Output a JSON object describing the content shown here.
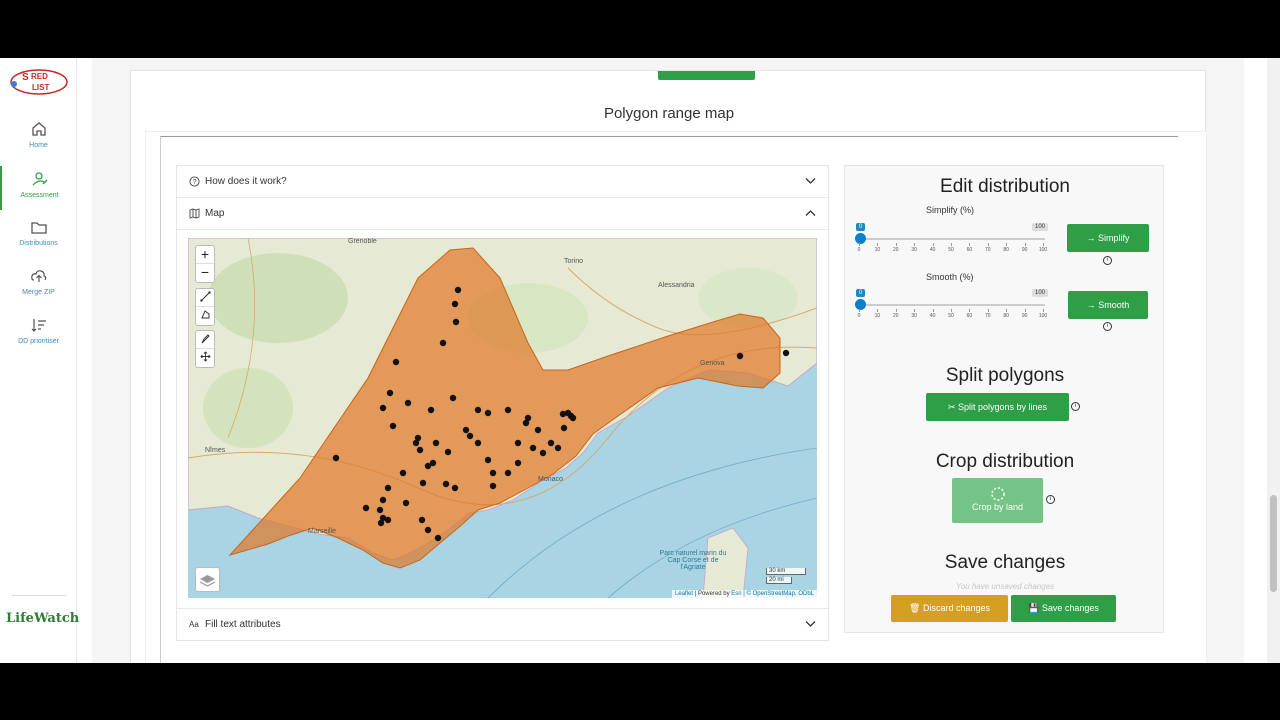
{
  "sidebar": {
    "logo_text": "RED LIST",
    "items": [
      {
        "label": "Home",
        "icon": "home-icon"
      },
      {
        "label": "Assessment",
        "icon": "user-edit-icon"
      },
      {
        "label": "Distributions",
        "icon": "folder-icon"
      },
      {
        "label": "Merge ZIP",
        "icon": "cloud-upload-icon"
      },
      {
        "label": "DD prioritiser",
        "icon": "sort-icon"
      }
    ],
    "partner_logo": "LifeWatch"
  },
  "section_title": "Polygon range map",
  "accordion": {
    "how_label": "How does it work?",
    "map_label": "Map",
    "fill_label": "Fill text attributes"
  },
  "map": {
    "zoom_in": "+",
    "zoom_out": "−",
    "scale_km": "30 km",
    "scale_mi": "20 mi",
    "attribution_leaflet": "Leaflet",
    "attribution_powered": " | Powered by ",
    "attribution_esri": "Esri",
    "attribution_osm": " | © OpenStreetMap, ODbL",
    "labels": {
      "torino": "Torino",
      "genova": "Genova",
      "monaco": "Monaco",
      "marseille": "Marseille",
      "nimes": "Nîmes",
      "grenoble": "Grenoble",
      "alessandria": "Alessandria",
      "corse": "Parc naturel marin du Cap Corse et de l'Agriate"
    }
  },
  "edit": {
    "title": "Edit distribution",
    "simplify_label": "Simplify (%)",
    "smooth_label": "Smooth (%)",
    "slider_min": "0",
    "slider_max": "100",
    "slider_value": 0,
    "ticks": [
      "0",
      "10",
      "20",
      "30",
      "40",
      "50",
      "60",
      "70",
      "80",
      "90",
      "100"
    ],
    "simplify_btn": "→ Simplify",
    "smooth_btn": "→ Smooth"
  },
  "split": {
    "title": "Split polygons",
    "button": "✂ Split polygons by lines"
  },
  "crop": {
    "title": "Crop distribution",
    "button": "Crop by land"
  },
  "save": {
    "title": "Save changes",
    "hint": "You have unsaved changes",
    "discard_btn": "🗑 Discard changes",
    "save_btn": "💾 Save changes"
  },
  "colors": {
    "green": "#2e9e47",
    "yellow": "#d5a021",
    "polygon": "#e07a2a"
  }
}
